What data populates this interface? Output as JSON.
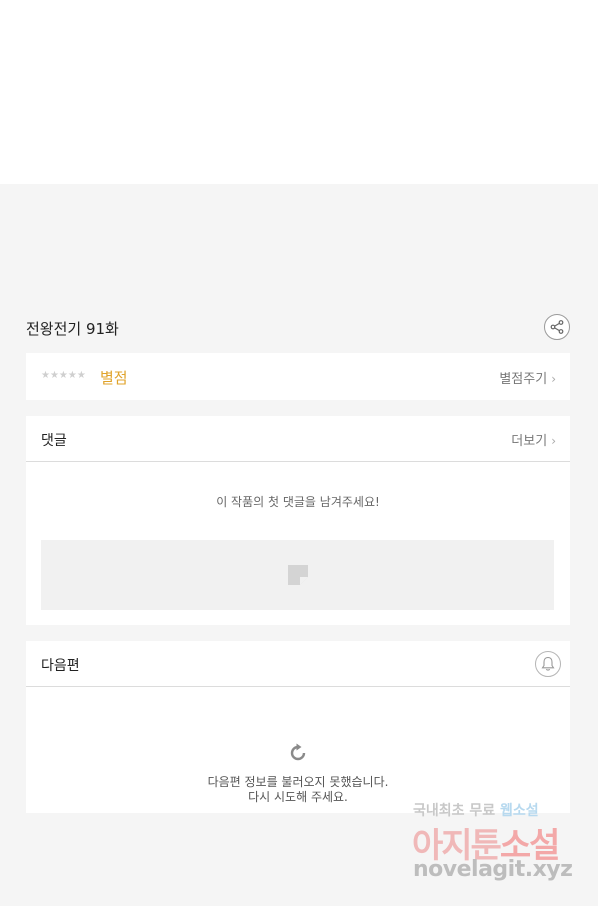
{
  "episode": {
    "title": "전왕전기 91화"
  },
  "rating": {
    "stars": "★★★★★",
    "label": "별점",
    "action_label": "별점주기"
  },
  "comments": {
    "title": "댓글",
    "more_label": "더보기",
    "empty_message": "이 작품의 첫 댓글을 남겨주세요!"
  },
  "next_episode": {
    "title": "다음편",
    "error_line1": "다음편 정보를 불러오지 못했습니다.",
    "error_line2": "다시 시도해 주세요."
  },
  "watermark": {
    "line1_prefix": "국내최초 무료 ",
    "line1_highlight": "웹소설",
    "line2_prefix": "아지툰",
    "line2_highlight": "소설",
    "line3": "novelagit.xyz"
  },
  "icons": {
    "share": "share-icon",
    "chevron": "chevron-right-icon",
    "note": "note-icon",
    "bell": "bell-icon",
    "reload": "reload-icon"
  },
  "colors": {
    "rating_accent": "#e0a32a",
    "background": "#f5f5f5"
  }
}
